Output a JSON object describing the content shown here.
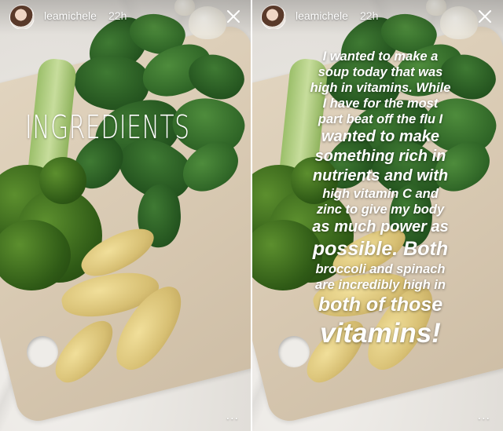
{
  "stories": [
    {
      "user": {
        "username": "leamichele",
        "time": "22h"
      },
      "overlay_text": "INGREDIENTS"
    },
    {
      "user": {
        "username": "leamichele",
        "time": "22h"
      },
      "caption_lines": [
        "I wanted to make a",
        "soup today that was",
        "high in vitamins. While",
        "I have for the most",
        "part beat off the flu I",
        "wanted to make",
        "something rich in",
        "nutrients and with",
        "high vitamin C and",
        "zinc to give my body",
        "as much power as",
        "possible. Both",
        "broccoli and spinach",
        "are incredibly high in",
        "both of those",
        "vitamins!"
      ]
    }
  ],
  "icons": {
    "close": "close-icon",
    "more": "more-options-icon"
  },
  "more_label": "..."
}
